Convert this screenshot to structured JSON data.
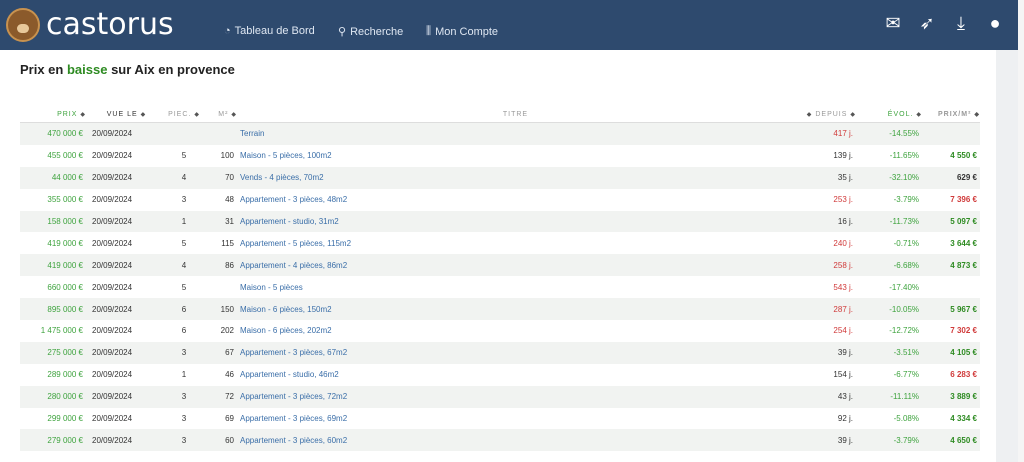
{
  "header": {
    "logo_text": "castorus",
    "nav": [
      {
        "icon": "dashboard-icon",
        "glyph": "◔",
        "label": "Tableau de Bord"
      },
      {
        "icon": "search-icon",
        "glyph": "⚲",
        "label": "Recherche"
      },
      {
        "icon": "sliders-icon",
        "glyph": "⫼",
        "label": "Mon Compte"
      }
    ],
    "icons": [
      {
        "name": "envelope-icon",
        "glyph": "✉"
      },
      {
        "name": "rocket-icon",
        "glyph": "➶"
      },
      {
        "name": "download-icon",
        "glyph": "⤓"
      },
      {
        "name": "user-icon",
        "glyph": "●"
      }
    ]
  },
  "page": {
    "title_prefix": "Prix en ",
    "title_highlight": "baisse",
    "title_suffix": " sur Aix en provence"
  },
  "table": {
    "headers": {
      "prix": "PRIX",
      "vue_le": "VUE LE",
      "piec": "PIEC.",
      "m2": "M²",
      "titre": "TITRE",
      "depuis": "DEPUIS",
      "evol": "ÉVOL.",
      "prix_m2": "PRIX/M²"
    },
    "rows": [
      {
        "prix": "470 000 €",
        "date": "20/09/2024",
        "piec": "",
        "m2": "",
        "titre": "Terrain",
        "depuis": "417 j.",
        "depuis_color": "#d03a3a",
        "evol": "-14.55%",
        "pm2": "",
        "pm2_color": "#333"
      },
      {
        "prix": "455 000 €",
        "date": "20/09/2024",
        "piec": "5",
        "m2": "100",
        "titre": "Maison - 5 pièces, 100m2",
        "depuis": "139 j.",
        "depuis_color": "#333",
        "evol": "-11.65%",
        "pm2": "4 550 €",
        "pm2_color": "#2e8b22"
      },
      {
        "prix": "44 000 €",
        "date": "20/09/2024",
        "piec": "4",
        "m2": "70",
        "titre": "Vends - 4 pièces, 70m2",
        "depuis": "35 j.",
        "depuis_color": "#333",
        "evol": "-32.10%",
        "pm2": "629 €",
        "pm2_color": "#333"
      },
      {
        "prix": "355 000 €",
        "date": "20/09/2024",
        "piec": "3",
        "m2": "48",
        "titre": "Appartement - 3 pièces, 48m2",
        "depuis": "253 j.",
        "depuis_color": "#d03a3a",
        "evol": "-3.79%",
        "pm2": "7 396 €",
        "pm2_color": "#d03a3a"
      },
      {
        "prix": "158 000 €",
        "date": "20/09/2024",
        "piec": "1",
        "m2": "31",
        "titre": "Appartement - studio, 31m2",
        "depuis": "16 j.",
        "depuis_color": "#333",
        "evol": "-11.73%",
        "pm2": "5 097 €",
        "pm2_color": "#2e8b22"
      },
      {
        "prix": "419 000 €",
        "date": "20/09/2024",
        "piec": "5",
        "m2": "115",
        "titre": "Appartement - 5 pièces, 115m2",
        "depuis": "240 j.",
        "depuis_color": "#d03a3a",
        "evol": "-0.71%",
        "pm2": "3 644 €",
        "pm2_color": "#2e8b22"
      },
      {
        "prix": "419 000 €",
        "date": "20/09/2024",
        "piec": "4",
        "m2": "86",
        "titre": "Appartement - 4 pièces, 86m2",
        "depuis": "258 j.",
        "depuis_color": "#d03a3a",
        "evol": "-6.68%",
        "pm2": "4 873 €",
        "pm2_color": "#2e8b22"
      },
      {
        "prix": "660 000 €",
        "date": "20/09/2024",
        "piec": "5",
        "m2": "",
        "titre": "Maison - 5 pièces",
        "depuis": "543 j.",
        "depuis_color": "#d03a3a",
        "evol": "-17.40%",
        "pm2": "",
        "pm2_color": "#333"
      },
      {
        "prix": "895 000 €",
        "date": "20/09/2024",
        "piec": "6",
        "m2": "150",
        "titre": "Maison - 6 pièces, 150m2",
        "depuis": "287 j.",
        "depuis_color": "#d03a3a",
        "evol": "-10.05%",
        "pm2": "5 967 €",
        "pm2_color": "#2e8b22"
      },
      {
        "prix": "1 475 000 €",
        "date": "20/09/2024",
        "piec": "6",
        "m2": "202",
        "titre": "Maison - 6 pièces, 202m2",
        "depuis": "254 j.",
        "depuis_color": "#d03a3a",
        "evol": "-12.72%",
        "pm2": "7 302 €",
        "pm2_color": "#d03a3a"
      },
      {
        "prix": "275 000 €",
        "date": "20/09/2024",
        "piec": "3",
        "m2": "67",
        "titre": "Appartement - 3 pièces, 67m2",
        "depuis": "39 j.",
        "depuis_color": "#333",
        "evol": "-3.51%",
        "pm2": "4 105 €",
        "pm2_color": "#2e8b22"
      },
      {
        "prix": "289 000 €",
        "date": "20/09/2024",
        "piec": "1",
        "m2": "46",
        "titre": "Appartement - studio, 46m2",
        "depuis": "154 j.",
        "depuis_color": "#333",
        "evol": "-6.77%",
        "pm2": "6 283 €",
        "pm2_color": "#d03a3a"
      },
      {
        "prix": "280 000 €",
        "date": "20/09/2024",
        "piec": "3",
        "m2": "72",
        "titre": "Appartement - 3 pièces, 72m2",
        "depuis": "43 j.",
        "depuis_color": "#333",
        "evol": "-11.11%",
        "pm2": "3 889 €",
        "pm2_color": "#2e8b22"
      },
      {
        "prix": "299 000 €",
        "date": "20/09/2024",
        "piec": "3",
        "m2": "69",
        "titre": "Appartement - 3 pièces, 69m2",
        "depuis": "92 j.",
        "depuis_color": "#333",
        "evol": "-5.08%",
        "pm2": "4 334 €",
        "pm2_color": "#2e8b22"
      },
      {
        "prix": "279 000 €",
        "date": "20/09/2024",
        "piec": "3",
        "m2": "60",
        "titre": "Appartement - 3 pièces, 60m2",
        "depuis": "39 j.",
        "depuis_color": "#333",
        "evol": "-3.79%",
        "pm2": "4 650 €",
        "pm2_color": "#2e8b22"
      }
    ]
  }
}
